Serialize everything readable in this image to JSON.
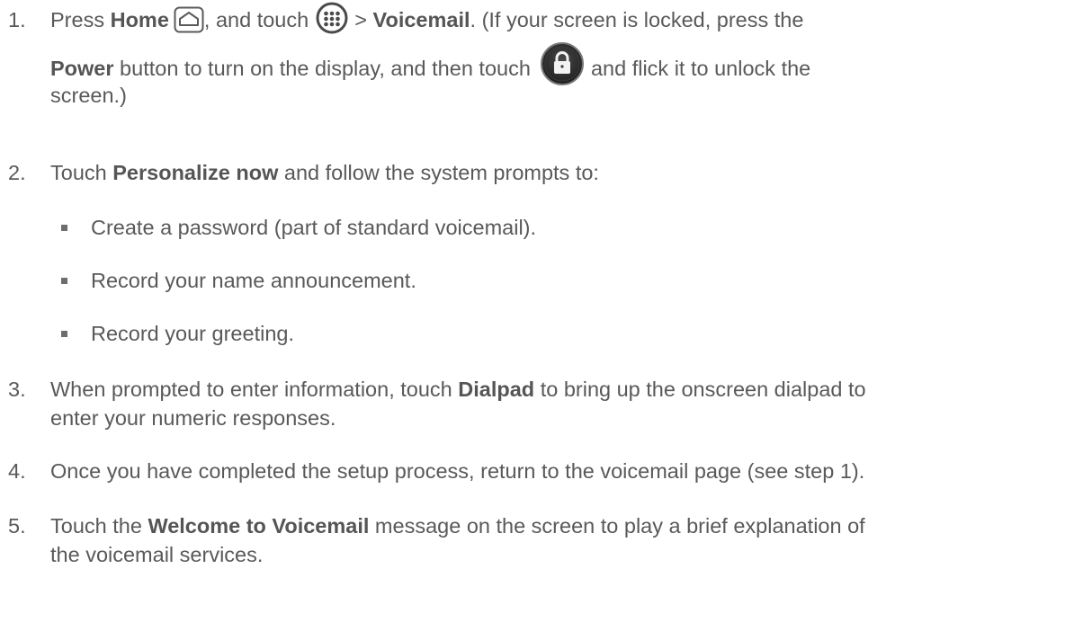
{
  "steps": [
    {
      "number": "1.",
      "line1_pre": "Press ",
      "line1_b1": "Home",
      "line1_mid": ", and touch ",
      "line1_gt": " > ",
      "line1_b2": "Voicemail",
      "line1_post": ". (If your screen is locked, press the",
      "line2_b": "Power",
      "line2_mid": " button to turn on the display, and then touch ",
      "line2_post": " and flick it to unlock the",
      "line3": "screen.)"
    },
    {
      "number": "2.",
      "pre": "Touch ",
      "bold": "Personalize now",
      "post": " and follow the system prompts to:"
    },
    {
      "number": "3.",
      "line1_pre": "When prompted to enter information, touch ",
      "line1_b": "Dialpad",
      "line1_post": " to bring up the onscreen dialpad to",
      "line2": "enter your numeric responses."
    },
    {
      "number": "4.",
      "text": "Once you have completed the setup process, return to the voicemail page (see step 1)."
    },
    {
      "number": "5.",
      "line1_pre": "Touch the ",
      "line1_b": "Welcome to Voicemail",
      "line1_post": " message on the screen to play a brief explanation of",
      "line2": "the voicemail services."
    }
  ],
  "bullets": [
    "Create a password (part of standard voicemail).",
    "Record your name announcement.",
    "Record your greeting."
  ],
  "icons": {
    "home": "home-key-icon",
    "apps": "apps-launcher-icon",
    "unlock": "lock-unlock-icon"
  },
  "colors": {
    "text": "#595959",
    "bold": "#555555",
    "lock_bg": "#2b2b2b",
    "lock_ring": "#6b6b6b"
  }
}
